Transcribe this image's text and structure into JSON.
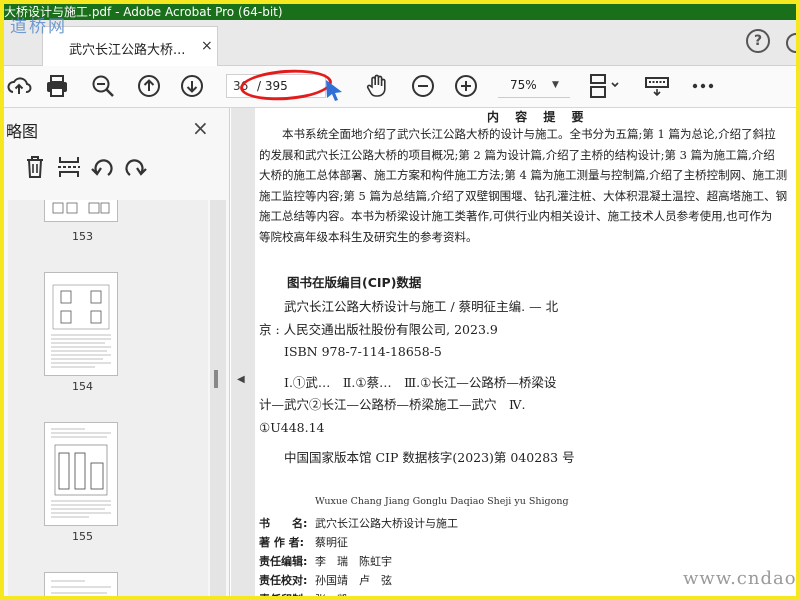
{
  "window": {
    "title": "大桥设计与施工.pdf - Adobe Acrobat Pro (64-bit)",
    "site_watermark": "道桥网"
  },
  "tabs": [
    {
      "label": "武穴长江公路大桥...",
      "close": "×"
    }
  ],
  "help_label": "?",
  "toolbar": {
    "current_page": "36",
    "total_pages": "/ 395",
    "zoom": "75%",
    "icons": [
      "upload-icon",
      "print-icon",
      "zoom-search-icon",
      "page-up-icon",
      "page-down-icon",
      "cursor-icon",
      "hand-icon",
      "zoom-out-icon",
      "zoom-in-icon",
      "page-layout-icon",
      "keyboard-icon",
      "more-icon"
    ],
    "annotation_color": "#e41b1b"
  },
  "side_panel": {
    "title": "略图",
    "close": "×",
    "tools": [
      "trash-icon",
      "insert-page-icon",
      "undo-icon",
      "redo-icon"
    ],
    "thumbnails": [
      {
        "page_label": "153"
      },
      {
        "page_label": "154"
      },
      {
        "page_label": "155"
      }
    ]
  },
  "document": {
    "heading": "内 容 提 要",
    "paragraph_lines": [
      "　　本书系统全面地介绍了武穴长江公路大桥的设计与施工。全书分为五篇;第 1 篇为总论,介绍了斜拉",
      "的发展和武穴长江公路大桥的项目概况;第 2 篇为设计篇,介绍了主桥的结构设计;第 3 篇为施工篇,介绍",
      "大桥的施工总体部署、施工方案和构件施工方法;第 4 篇为施工测量与控制篇,介绍了主桥控制网、施工测",
      "施工监控等内容;第 5 篇为总结篇,介绍了双壁钢围堰、钻孔灌注桩、大体积混凝土温控、超高塔施工、钢",
      "施工总结等内容。本书为桥梁设计施工类著作,可供行业内相关设计、施工技术人员参考使用,也可作为",
      "等院校高年级本科生及研究生的参考资料。"
    ],
    "cip_title": "图书在版编目(CIP)数据",
    "cip_lines": [
      "　　武穴长江公路大桥设计与施工 / 蔡明征主编. — 北",
      "京 : 人民交通出版社股份有限公司, 2023.9",
      "　　ISBN 978-7-114-18658-5",
      "　　Ⅰ.①武…　Ⅱ.①蔡…　Ⅲ.①长江—公路桥—桥梁设",
      "计—武穴②长江—公路桥—桥梁施工—武穴　Ⅳ.",
      "①U448.14",
      "　　中国国家版本馆 CIP 数据核字(2023)第 040283 号"
    ],
    "romanized_title": "Wuxue Chang Jiang Gonglu Daqiao Sheji yu Shigong",
    "credits": [
      {
        "key": "书　　名:",
        "value": "武穴长江公路大桥设计与施工"
      },
      {
        "key": "著 作 者:",
        "value": "蔡明征"
      },
      {
        "key": "责任编辑:",
        "value": "李　瑞　陈虹宇"
      },
      {
        "key": "责任校对:",
        "value": "孙国靖　卢　弦"
      },
      {
        "key": "责任印制:",
        "value": "张　凯"
      }
    ],
    "corner_watermark": "www.cndao.com"
  }
}
